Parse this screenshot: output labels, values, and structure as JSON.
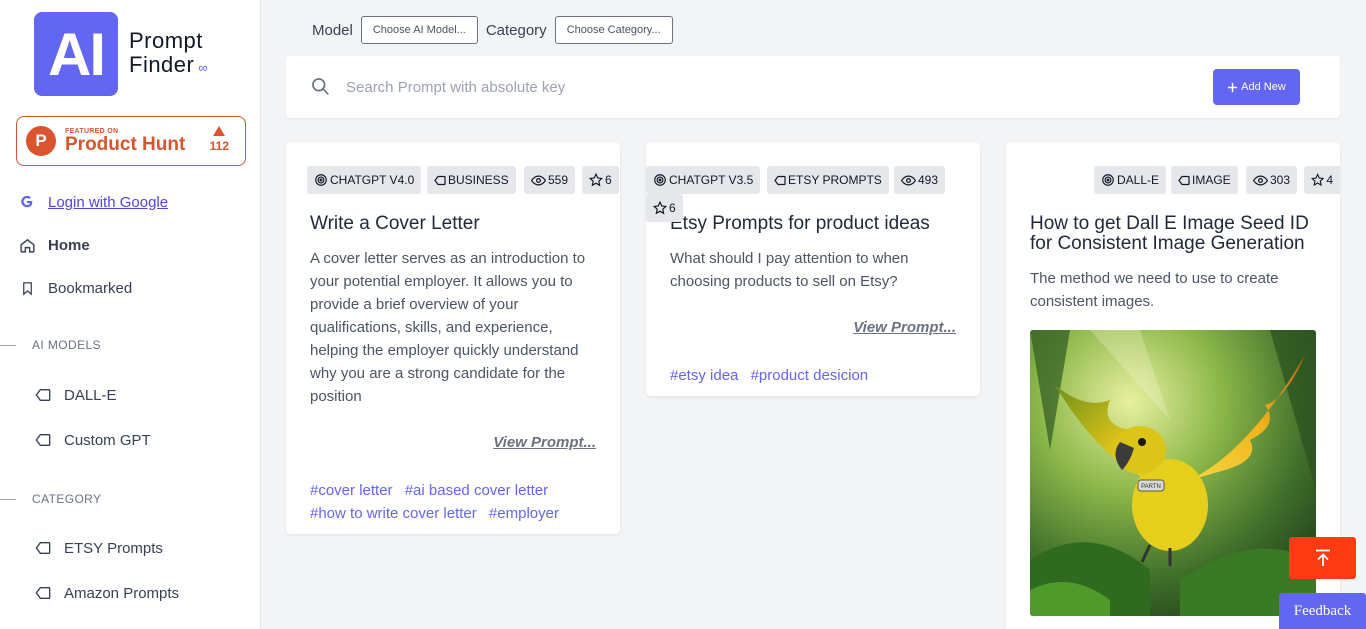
{
  "sidebar": {
    "logo_mark": "AI",
    "logo_line1": "Prompt",
    "logo_line2": "Finder",
    "product_hunt": {
      "featured": "FEATURED ON",
      "name": "Product Hunt",
      "votes": "112",
      "letter": "P"
    },
    "login": "Login with Google",
    "home": "Home",
    "bookmarked": "Bookmarked",
    "ai_models_head": "AI MODELS",
    "ai_models": [
      "DALL-E",
      "Custom GPT"
    ],
    "category_head": "CATEGORY",
    "categories": [
      "ETSY Prompts",
      "Amazon Prompts"
    ]
  },
  "filters": {
    "model_label": "Model",
    "model_btn": "Choose AI Model...",
    "category_label": "Category",
    "category_btn": "Choose Category..."
  },
  "search": {
    "placeholder": "Search Prompt with absolute key",
    "add_new": "Add New"
  },
  "cards": [
    {
      "model": "CHATGPT V4.0",
      "category": "BUSINESS",
      "views": "559",
      "stars": "6",
      "title": "Write a Cover Letter",
      "desc": "A cover letter serves as an introduction to your potential employer. It allows you to provide a brief overview of your qualifications, skills, and experience, helping the employer quickly understand why you are a strong candidate for the position",
      "view": "View Prompt...",
      "tags": [
        "#cover letter",
        "#ai based cover letter",
        "#how to write cover letter",
        "#employer"
      ]
    },
    {
      "model": "CHATGPT V3.5",
      "category": "ETSY PROMPTS",
      "views": "493",
      "stars": "6",
      "title": "Etsy Prompts for product ideas",
      "desc": "What should I pay attention to when choosing products to sell on Etsy?",
      "view": "View Prompt...",
      "tags": [
        "#etsy idea",
        "#product desicion"
      ]
    },
    {
      "model": "DALL-E",
      "category": "IMAGE",
      "views": "303",
      "stars": "4",
      "title": "How to get Dall E Image Seed ID for Consistent Image Generation",
      "desc": "The method we need to use to create consistent images.",
      "image_tag": "PARTN"
    }
  ],
  "feedback": "Feedback",
  "colors": {
    "accent": "#6366f1",
    "product_hunt": "#da552f",
    "scroll_top": "#ff3b14"
  }
}
